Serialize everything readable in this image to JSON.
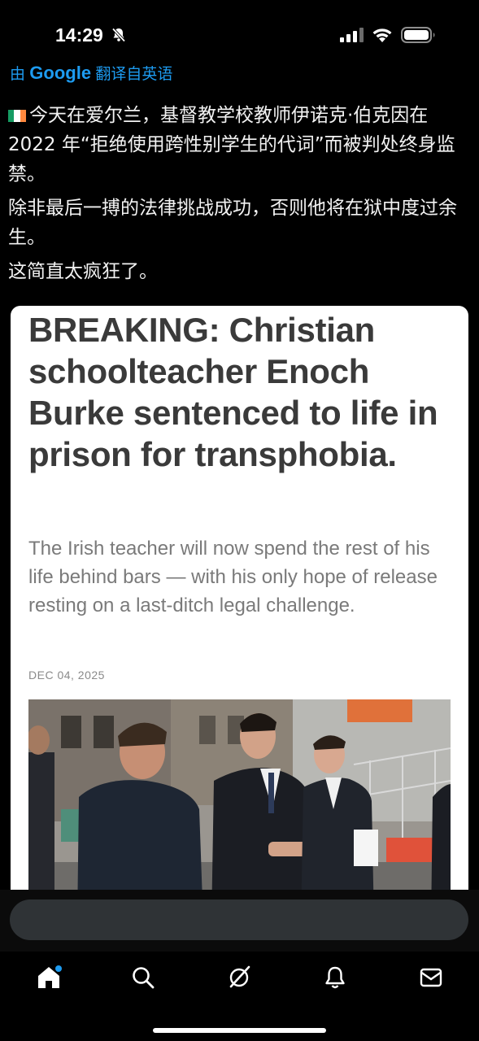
{
  "status_bar": {
    "time": "14:29"
  },
  "translation": {
    "prefix": "由",
    "provider": "Google",
    "suffix": "翻译自英语"
  },
  "post": {
    "paragraphs": [
      "今天在爱尔兰，基督教学校教师伊诺克·伯克因在 2022 年“拒绝使用跨性别学生的代词”而被判处终身监禁。",
      "除非最后一搏的法律挑战成功，否则他将在狱中度过余生。",
      "这简直太疯狂了。"
    ],
    "flag_colors": [
      "#169b62",
      "#ffffff",
      "#ff883e"
    ]
  },
  "card": {
    "headline": "BREAKING: Christian schoolteacher Enoch Burke sentenced to life in prison for transphobia.",
    "subheadline": "The Irish teacher will now spend the rest of his life behind bars — with his only hope of release resting on a last-ditch legal challenge.",
    "date": "DEC 04, 2025"
  },
  "reply": {
    "placeholder": ""
  },
  "tabs": [
    {
      "name": "home",
      "icon": "home-icon"
    },
    {
      "name": "search",
      "icon": "search-icon"
    },
    {
      "name": "grok",
      "icon": "grok-icon"
    },
    {
      "name": "notifications",
      "icon": "bell-icon"
    },
    {
      "name": "messages",
      "icon": "mail-icon"
    }
  ],
  "colors": {
    "accent": "#1d9bf0",
    "background": "#000000"
  }
}
